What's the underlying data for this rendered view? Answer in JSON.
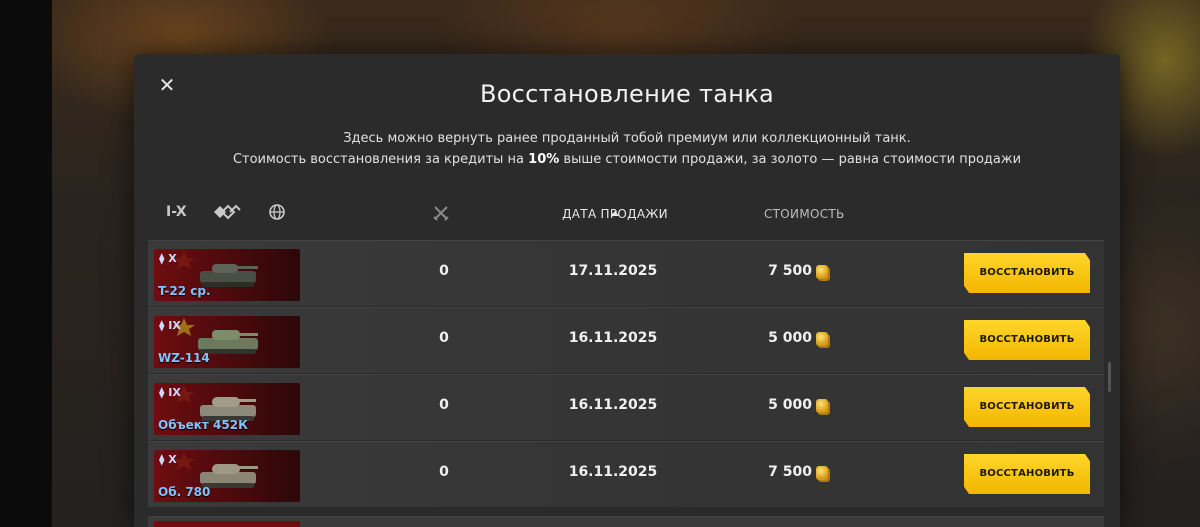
{
  "dialog": {
    "title": "Восстановление танка",
    "desc_line1": "Здесь можно вернуть ранее проданный тобой премиум или коллекционный танк.",
    "desc_line2_before": "Стоимость восстановления за кредиты на ",
    "desc_line2_bold": "10%",
    "desc_line2_after": " выше стоимости продажи, за золото — равна стоимости продажи",
    "close_icon": "close-icon"
  },
  "filters": {
    "tier_label": "I-X",
    "class_icon": "vehicle-class-filter-icon",
    "nation_icon": "globe-icon",
    "battles_icon": "crossed-swords-icon"
  },
  "columns": {
    "sale_date": "ДАТА ПРОДАЖИ",
    "cost": "СТОИМОСТЬ",
    "sort_column": "sale_date",
    "sort_direction": "ascending-arrow"
  },
  "rows": [
    {
      "tier": "X",
      "name": "T-22 ср.",
      "count": "0",
      "date": "17.11.2025",
      "price": "7 500",
      "button": "ВОССТАНОВИТЬ"
    },
    {
      "tier": "IX",
      "name": "WZ-114",
      "count": "0",
      "date": "16.11.2025",
      "price": "5 000",
      "button": "ВОССТАНОВИТЬ"
    },
    {
      "tier": "IX",
      "name": "Объект 452К",
      "count": "0",
      "date": "16.11.2025",
      "price": "5 000",
      "button": "ВОССТАНОВИТЬ"
    },
    {
      "tier": "X",
      "name": "Об. 780",
      "count": "0",
      "date": "16.11.2025",
      "price": "7 500",
      "button": "ВОССТАНОВИТЬ"
    }
  ],
  "colors": {
    "button_yellow": "#ffd62a",
    "tank_name_blue": "#7fc4ff",
    "thumb_red": "#6e0d10"
  },
  "currency_icon": "gold-coins-icon"
}
